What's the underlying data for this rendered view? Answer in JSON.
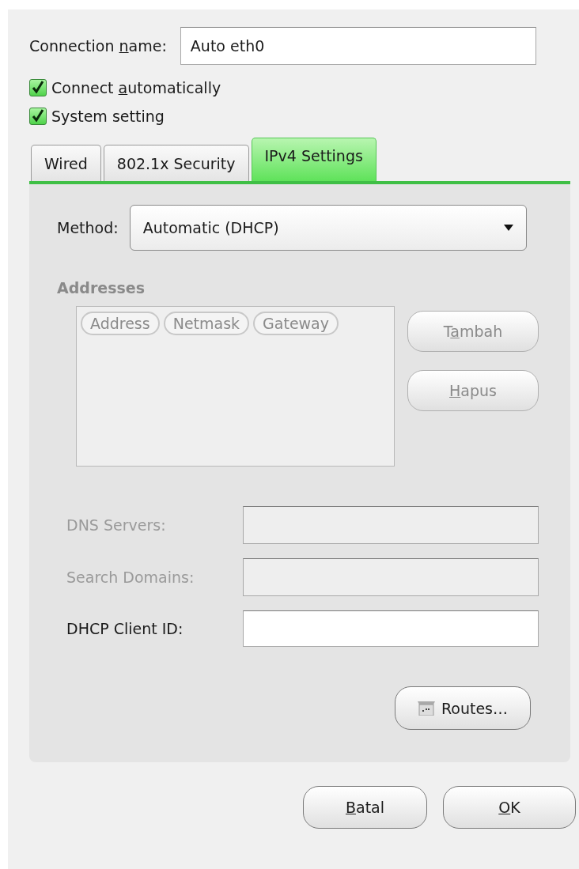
{
  "connection_name": {
    "label": [
      {
        "text": "Connection "
      },
      {
        "text": "n",
        "underline": true
      },
      {
        "text": "ame:"
      }
    ],
    "value": "Auto eth0"
  },
  "checkboxes": [
    {
      "label": [
        {
          "text": "Connect "
        },
        {
          "text": "a",
          "underline": true
        },
        {
          "text": "utomatically"
        }
      ],
      "checked": true
    },
    {
      "label": [
        {
          "text": "System setting"
        }
      ],
      "checked": true
    }
  ],
  "tabs": [
    {
      "label": "Wired",
      "selected": false
    },
    {
      "label": "802.1x Security",
      "selected": false
    },
    {
      "label": "IPv4 Settings",
      "selected": true
    }
  ],
  "method": {
    "label": "Method:",
    "value": "Automatic (DHCP)"
  },
  "addresses": {
    "title": "Addresses",
    "disabled": true,
    "columns": [
      "Address",
      "Netmask",
      "Gateway"
    ],
    "buttons": [
      {
        "label": [
          {
            "text": "T"
          },
          {
            "text": "a",
            "underline": true
          },
          {
            "text": "mbah"
          }
        ],
        "disabled": true
      },
      {
        "label": [
          {
            "text": "H",
            "underline": true
          },
          {
            "text": "apus"
          }
        ],
        "disabled": true
      }
    ]
  },
  "fields": [
    {
      "label": "DNS Servers:",
      "disabled": true
    },
    {
      "label": "Search Domains:",
      "disabled": true
    },
    {
      "label": "DHCP Client ID:",
      "disabled": false
    }
  ],
  "routes_button": {
    "label": "Routes…"
  },
  "footer_buttons": [
    {
      "label": [
        {
          "text": "B",
          "underline": true
        },
        {
          "text": "atal"
        }
      ]
    },
    {
      "label": [
        {
          "text": "O",
          "underline": true
        },
        {
          "text": "K"
        }
      ]
    }
  ]
}
